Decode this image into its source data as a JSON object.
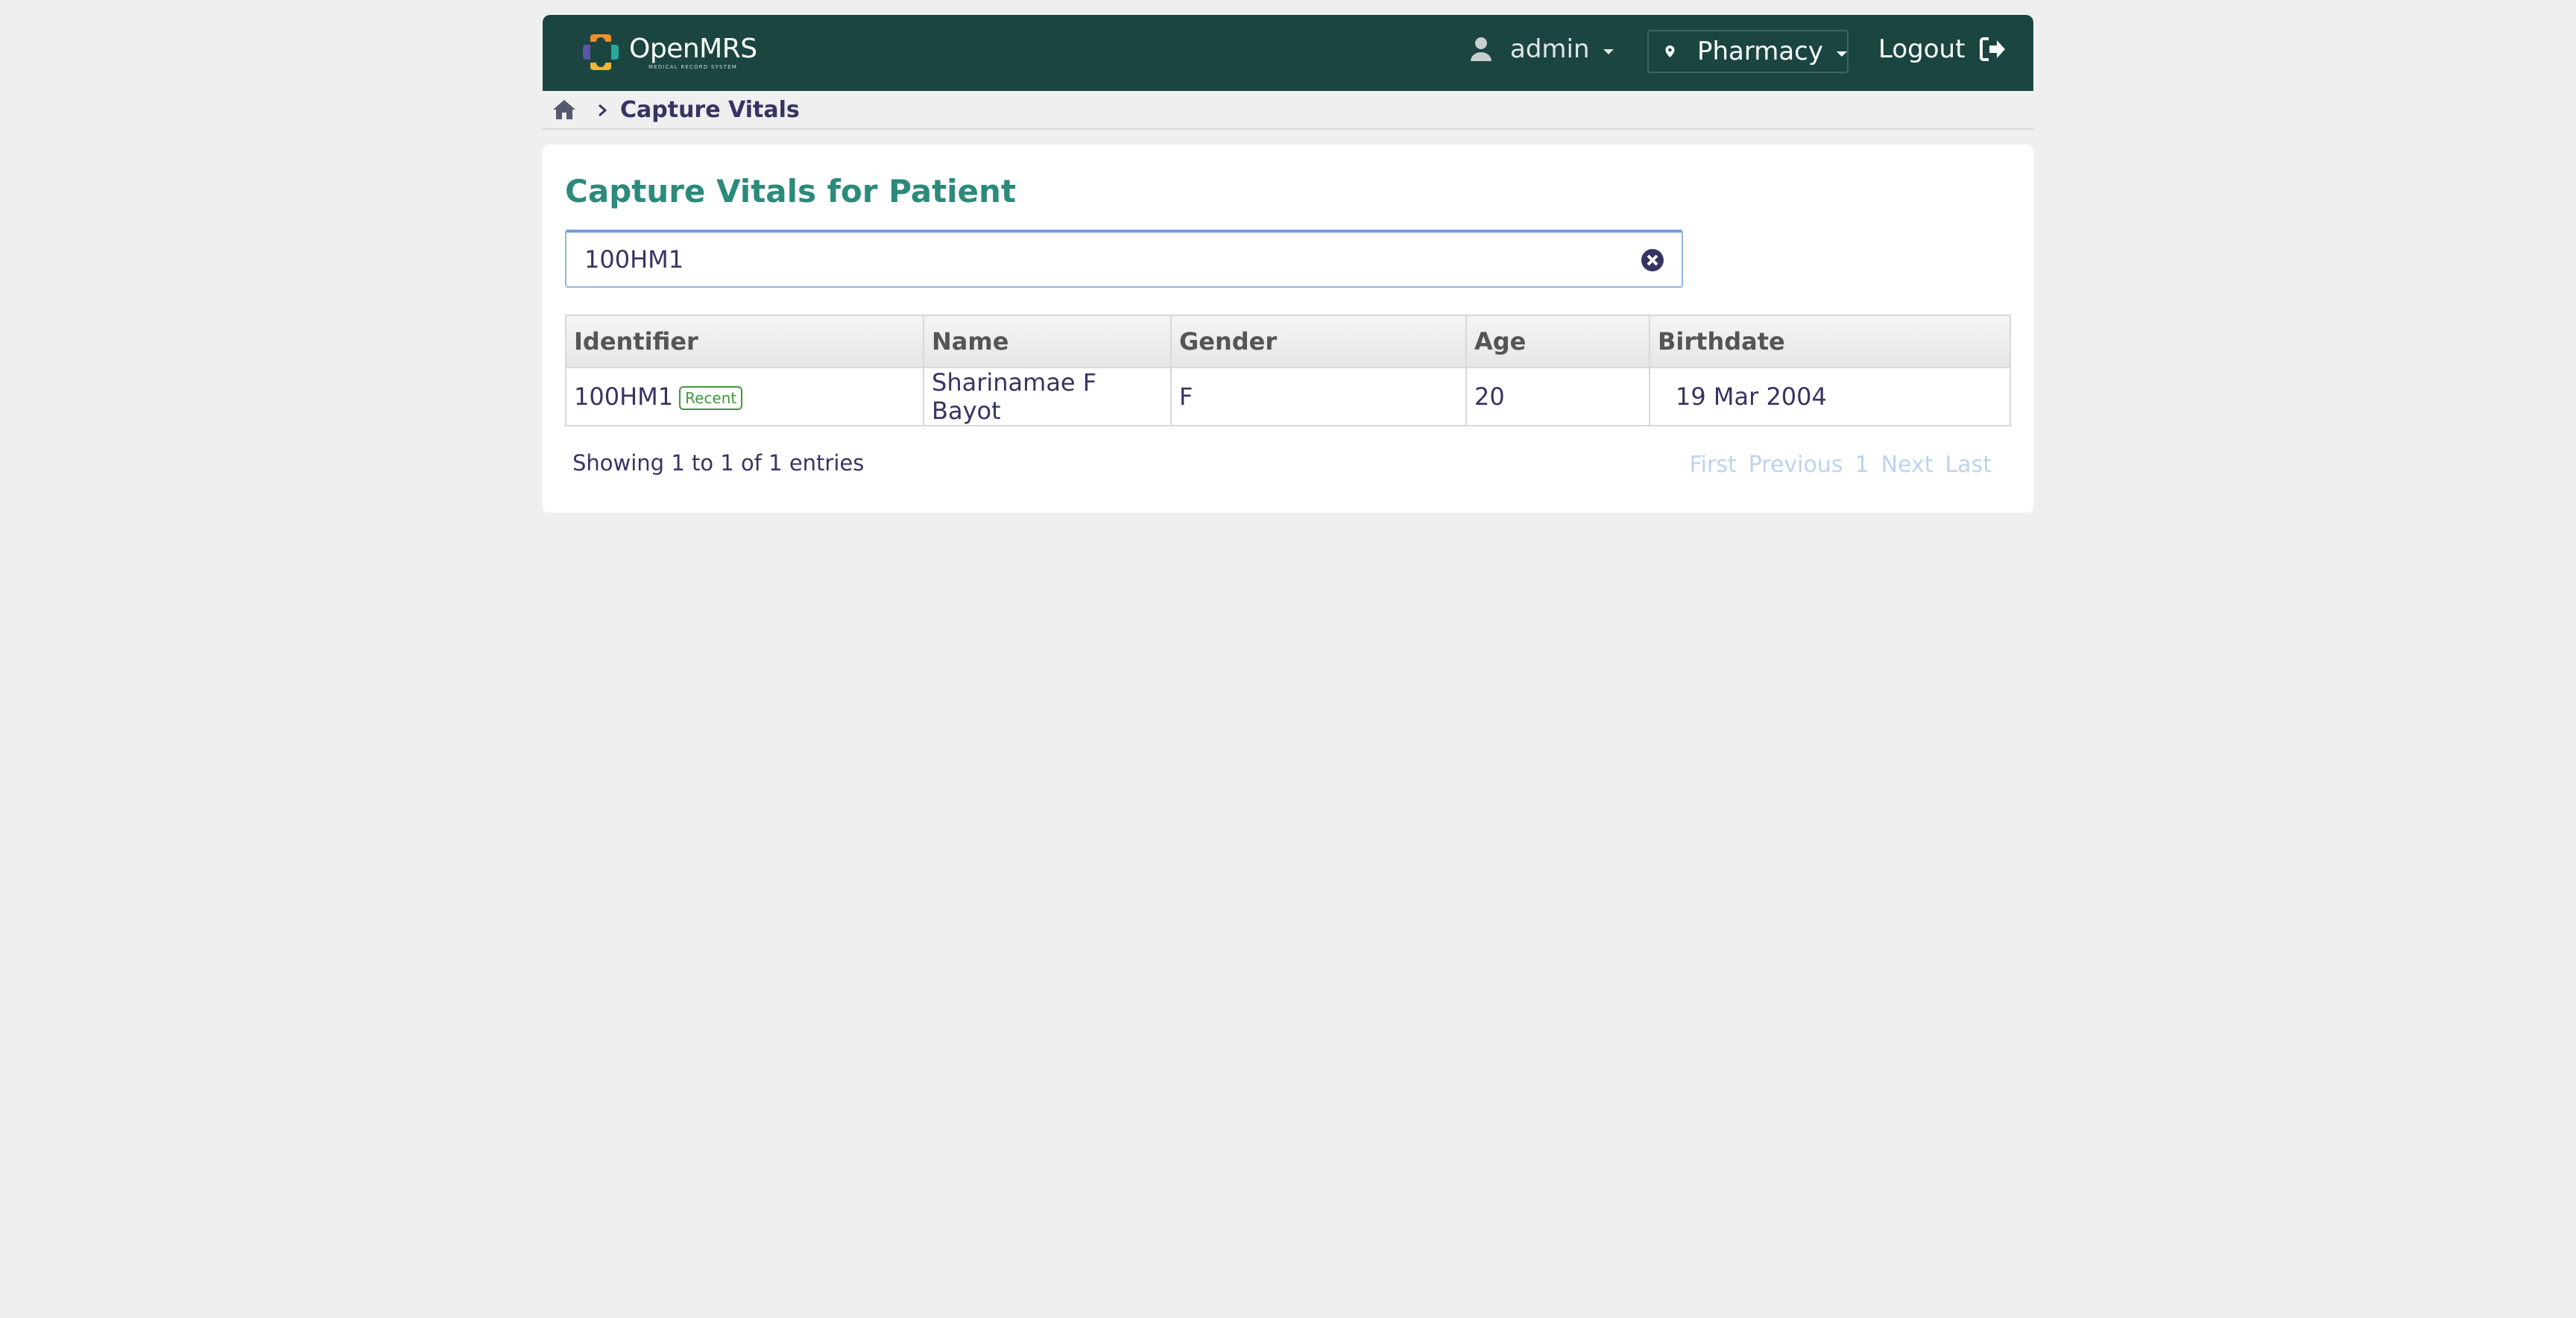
{
  "header": {
    "logo_text": "OpenMRS",
    "logo_subtext": "MEDICAL RECORD SYSTEM",
    "user": "admin",
    "location": "Pharmacy",
    "logout": "Logout"
  },
  "breadcrumb": {
    "current": "Capture Vitals"
  },
  "page": {
    "title": "Capture Vitals for Patient"
  },
  "search": {
    "value": "100HM1"
  },
  "table": {
    "columns": [
      "Identifier",
      "Name",
      "Gender",
      "Age",
      "Birthdate"
    ],
    "rows": [
      {
        "identifier": "100HM1",
        "badge": "Recent",
        "name": "Sharinamae F Bayot",
        "gender": "F",
        "age": "20",
        "birthdate": "19 Mar 2004"
      }
    ]
  },
  "footer": {
    "entries_info": "Showing 1 to 1 of 1 entries",
    "pager": {
      "first": "First",
      "previous": "Previous",
      "page": "1",
      "next": "Next",
      "last": "Last"
    }
  },
  "colors": {
    "header_bg": "#1b4540",
    "title": "#2b8a7b",
    "badge": "#3c9a3c",
    "pager_disabled": "#bcd3ee"
  }
}
